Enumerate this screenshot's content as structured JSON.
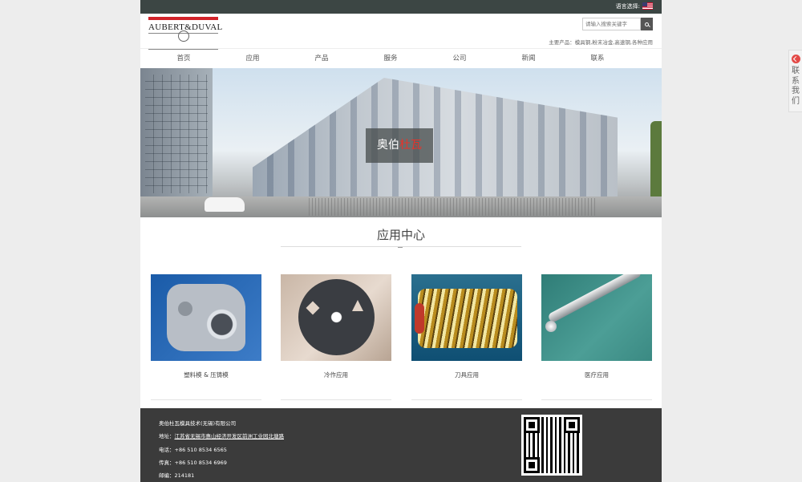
{
  "topbar": {
    "language_label": "语言选择:"
  },
  "header": {
    "logo_text": "AUBERT&DUVAL",
    "search_placeholder": "请输入搜索关键字",
    "products_text": "主要产品：模具钢,粉末冶金,高速钢,各种应用"
  },
  "nav": [
    "首页",
    "应用",
    "产品",
    "服务",
    "公司",
    "新闻",
    "联系"
  ],
  "banner": {
    "title_part1": "奥伯",
    "title_part2": "杜瓦"
  },
  "section": {
    "title": "应用中心"
  },
  "cards": [
    {
      "label": "塑料模 & 压铸模"
    },
    {
      "label": "冷作应用"
    },
    {
      "label": "刀具应用"
    },
    {
      "label": "医疗应用"
    }
  ],
  "footer": {
    "company": "奥伯杜瓦模具技术(无锡)有限公司",
    "address_label": "地址：",
    "address": "江苏省无锡市惠山经济开发区前洲工业园北塘路",
    "phone": "电话：+86 510 8534 6565",
    "fax": "传真：+86 510 8534 6969",
    "postcode": "邮编：214181"
  },
  "side_tab": {
    "text": "联系我们"
  },
  "colors": {
    "topbar": "#3c4644",
    "footer": "#3b3b3b",
    "accent_red": "#d2232a"
  }
}
